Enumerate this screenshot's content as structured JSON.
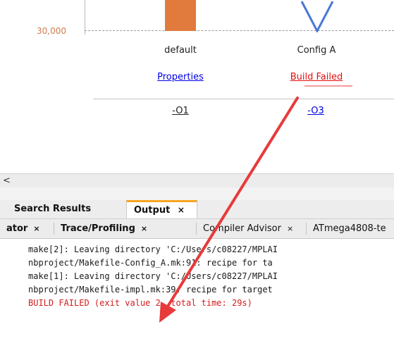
{
  "chart": {
    "y_tick_label": "30,000",
    "columns": [
      {
        "name": "default",
        "link": "Properties",
        "option": "-O1"
      },
      {
        "name": "Config A",
        "link": "Build Failed",
        "option": "-O3"
      }
    ]
  },
  "scrollbar": {
    "left_arrow": "<"
  },
  "output_tabs": [
    {
      "label": "Search Results"
    },
    {
      "label": "Output",
      "close": "×"
    }
  ],
  "sub_tabs": [
    {
      "label": "ator",
      "close": "×"
    },
    {
      "label": "Trace/Profiling",
      "close": "×"
    },
    {
      "label": "Compiler Advisor",
      "close": "×"
    },
    {
      "label": "ATmega4808-te"
    }
  ],
  "output_lines": [
    "make[2]: Leaving directory 'C:/Users/c08227/MPLAI",
    "nbproject/Makefile-Config_A.mk:91: recipe for ta",
    "make[1]: Leaving directory 'C:/Users/c08227/MPLAI",
    "nbproject/Makefile-impl.mk:39: recipe for target",
    "BUILD FAILED (exit value 2, total time: 29s)"
  ],
  "colors": {
    "bar_default": "#e07b3d",
    "config_a_line": "#4b77d6",
    "build_failed": "#e30d0d",
    "active_tab_accent": "#f5a623",
    "arrow": "#e83a3a"
  }
}
